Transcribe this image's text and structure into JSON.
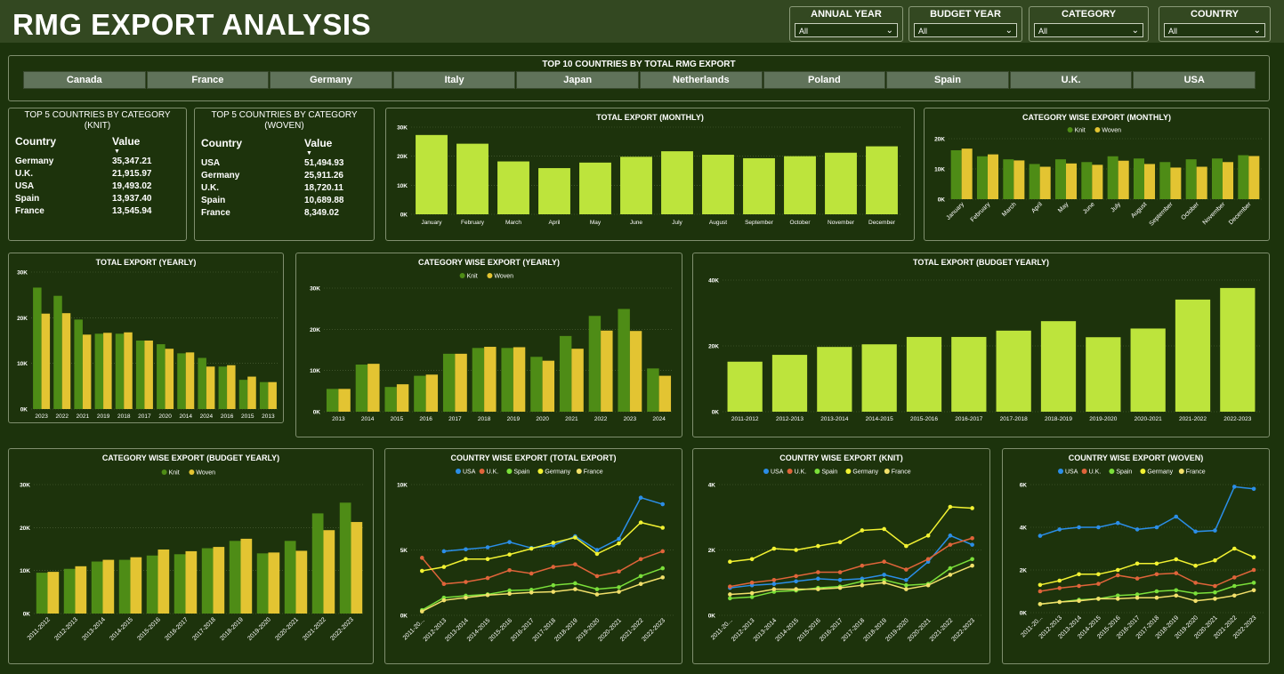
{
  "header": {
    "title": "RMG EXPORT ANALYSIS"
  },
  "filters": [
    {
      "label": "ANNUAL YEAR",
      "value": "All"
    },
    {
      "label": "BUDGET YEAR",
      "value": "All"
    },
    {
      "label": "CATEGORY",
      "value": "All"
    },
    {
      "label": "COUNTRY",
      "value": "All"
    }
  ],
  "colors": {
    "knit": "#4e8c16",
    "woven": "#e3c432",
    "total": "#bde43c",
    "USA": "#2b8ee8",
    "U.K.": "#e0643a",
    "Spain": "#7be03a",
    "Germany": "#f2f232",
    "France": "#f2e06a"
  },
  "top10": {
    "title": "TOP 10 COUNTRIES BY TOTAL RMG EXPORT",
    "countries": [
      "Canada",
      "France",
      "Germany",
      "Italy",
      "Japan",
      "Netherlands",
      "Poland",
      "Spain",
      "U.K.",
      "USA"
    ]
  },
  "knit_table": {
    "title": "TOP 5 COUNTRIES BY CATEGORY (KNIT)",
    "col_country": "Country",
    "col_value": "Value",
    "rows": [
      [
        "Germany",
        "35,347.21"
      ],
      [
        "U.K.",
        "21,915.97"
      ],
      [
        "USA",
        "19,493.02"
      ],
      [
        "Spain",
        "13,937.40"
      ],
      [
        "France",
        "13,545.94"
      ]
    ]
  },
  "woven_table": {
    "title": "TOP 5 COUNTRIES BY CATEGORY (WOVEN)",
    "col_country": "Country",
    "col_value": "Value",
    "rows": [
      [
        "USA",
        "51,494.93"
      ],
      [
        "Germany",
        "25,911.26"
      ],
      [
        "U.K.",
        "18,720.11"
      ],
      [
        "Spain",
        "10,689.88"
      ],
      [
        "France",
        "8,349.02"
      ]
    ]
  },
  "chart_data": [
    {
      "id": "monthly",
      "type": "bar",
      "title": "TOTAL EXPORT (MONTHLY)",
      "categories": [
        "January",
        "February",
        "March",
        "April",
        "May",
        "June",
        "July",
        "August",
        "September",
        "October",
        "November",
        "December"
      ],
      "values": [
        27300,
        24300,
        18200,
        15900,
        17800,
        19800,
        21700,
        20500,
        19300,
        20000,
        21200,
        23400
      ],
      "yticks": [
        "0K",
        "10K",
        "20K",
        "30K"
      ],
      "ylim": [
        0,
        30000
      ]
    },
    {
      "id": "cat_monthly",
      "type": "bar",
      "title": "CATEGORY WISE EXPORT (MONTHLY)",
      "categories": [
        "January",
        "February",
        "March",
        "April",
        "May",
        "June",
        "July",
        "August",
        "September",
        "October",
        "November",
        "December"
      ],
      "series": [
        {
          "name": "Knit",
          "values": [
            17800,
            15600,
            14500,
            12800,
            14500,
            13500,
            15600,
            14800,
            13500,
            14500,
            14800,
            16000
          ]
        },
        {
          "name": "Woven",
          "values": [
            18400,
            16300,
            14100,
            11800,
            13000,
            12500,
            14000,
            12800,
            11500,
            11800,
            13500,
            15700
          ]
        }
      ],
      "yticks": [
        "0K",
        "10K",
        "20K"
      ],
      "ylim": [
        0,
        22000
      ]
    },
    {
      "id": "yearly",
      "type": "bar",
      "title": "TOTAL EXPORT (YEARLY)",
      "categories": [
        "2023",
        "2022",
        "2021",
        "2019",
        "2018",
        "2017",
        "2020",
        "2014",
        "2024",
        "2016",
        "2015",
        "2013"
      ],
      "series": [
        {
          "name": "Knit",
          "values": [
            26600,
            24800,
            19600,
            16500,
            16500,
            15000,
            14200,
            12200,
            11200,
            9300,
            6400,
            5900
          ]
        },
        {
          "name": "Woven",
          "values": [
            20900,
            21000,
            16300,
            16700,
            16800,
            15000,
            13200,
            12400,
            9300,
            9600,
            7100,
            5900
          ]
        }
      ],
      "yticks": [
        "0K",
        "10K",
        "20K",
        "30K"
      ],
      "ylim": [
        0,
        30000
      ]
    },
    {
      "id": "cat_yearly",
      "type": "bar",
      "title": "CATEGORY WISE EXPORT (YEARLY)",
      "categories": [
        "2013",
        "2014",
        "2015",
        "2016",
        "2017",
        "2018",
        "2019",
        "2020",
        "2021",
        "2022",
        "2023",
        "2024"
      ],
      "series": [
        {
          "name": "Knit",
          "values": [
            5900,
            12200,
            6400,
            9300,
            15000,
            16500,
            16500,
            14200,
            19600,
            24800,
            26600,
            11200
          ]
        },
        {
          "name": "Woven",
          "values": [
            5900,
            12400,
            7100,
            9600,
            15000,
            16800,
            16700,
            13200,
            16300,
            21000,
            20900,
            9300
          ]
        }
      ],
      "yticks": [
        "0K",
        "10K",
        "20K",
        "30K"
      ],
      "ylim": [
        0,
        32000
      ]
    },
    {
      "id": "budget_yearly",
      "type": "bar",
      "title": "TOTAL EXPORT (BUDGET YEARLY)",
      "categories": [
        "2011-2012",
        "2012-2013",
        "2013-2014",
        "2014-2015",
        "2015-2016",
        "2016-2017",
        "2017-2018",
        "2018-2019",
        "2019-2020",
        "2020-2021",
        "2021-2022",
        "2022-2023"
      ],
      "values": [
        19000,
        21600,
        24600,
        25600,
        28400,
        28400,
        30800,
        34400,
        28300,
        31600,
        42600,
        47000
      ],
      "yticks": [
        "0K",
        "20K",
        "40K"
      ],
      "ylim": [
        0,
        50000
      ]
    },
    {
      "id": "cat_budget",
      "type": "bar",
      "title": "CATEGORY WISE EXPORT (BUDGET YEARLY)",
      "categories": [
        "2011-2012",
        "2012-2013",
        "2013-2014",
        "2014-2015",
        "2015-2016",
        "2016-2017",
        "2017-2018",
        "2018-2019",
        "2019-2020",
        "2020-2021",
        "2021-2022",
        "2022-2023"
      ],
      "series": [
        {
          "name": "Knit",
          "values": [
            9500,
            10400,
            12100,
            12500,
            13500,
            13800,
            15200,
            16900,
            14000,
            16900,
            23300,
            25800
          ]
        },
        {
          "name": "Woven",
          "values": [
            9700,
            11000,
            12500,
            13100,
            14900,
            14500,
            15500,
            17400,
            14200,
            14600,
            19400,
            21300
          ]
        }
      ],
      "yticks": [
        "0K",
        "10K",
        "20K",
        "30K"
      ],
      "ylim": [
        0,
        30000
      ]
    },
    {
      "id": "country_total",
      "type": "line",
      "title": "COUNTRY WISE EXPORT (TOTAL EXPORT)",
      "categories": [
        "2011-20...",
        "2012-2013",
        "2013-2014",
        "2014-2015",
        "2015-2016",
        "2016-2017",
        "2017-2018",
        "2018-2019",
        "2019-2020",
        "2020-2021",
        "2021-2022",
        "2022-2023"
      ],
      "series": [
        {
          "name": "USA",
          "values": [
            null,
            4900,
            5050,
            5200,
            5600,
            5150,
            5350,
            6050,
            5000,
            5850,
            9000,
            8500
          ]
        },
        {
          "name": "U.K.",
          "values": [
            4400,
            2400,
            2550,
            2850,
            3450,
            3200,
            3700,
            3900,
            3000,
            3350,
            4300,
            4900
          ]
        },
        {
          "name": "Spain",
          "values": [
            400,
            1350,
            1500,
            1600,
            1900,
            1950,
            2300,
            2450,
            2000,
            2150,
            3000,
            3600
          ]
        },
        {
          "name": "Germany",
          "values": [
            3400,
            3700,
            4300,
            4300,
            4650,
            5100,
            5550,
            5950,
            4700,
            5500,
            7100,
            6700
          ]
        },
        {
          "name": "France",
          "values": [
            300,
            1150,
            1350,
            1550,
            1650,
            1750,
            1800,
            2000,
            1600,
            1800,
            2400,
            2900
          ]
        }
      ],
      "yticks": [
        "0K",
        "5K",
        "10K"
      ],
      "ylim": [
        0,
        10000
      ]
    },
    {
      "id": "country_knit",
      "type": "line",
      "title": "COUNTRY WISE EXPORT (KNIT)",
      "categories": [
        "2011-20...",
        "2012-2013",
        "2013-2014",
        "2014-2015",
        "2015-2016",
        "2016-2017",
        "2017-2018",
        "2018-2019",
        "2019-2020",
        "2020-2021",
        "2021-2022",
        "2022-2023"
      ],
      "series": [
        {
          "name": "USA",
          "values": [
            1050,
            1150,
            1200,
            1300,
            1400,
            1350,
            1400,
            1550,
            1350,
            2050,
            3050,
            2700
          ]
        },
        {
          "name": "U.K.",
          "values": [
            1100,
            1250,
            1350,
            1500,
            1650,
            1650,
            1900,
            2050,
            1750,
            2150,
            2700,
            2950
          ]
        },
        {
          "name": "Spain",
          "values": [
            650,
            700,
            900,
            950,
            1050,
            1100,
            1300,
            1350,
            1150,
            1200,
            1800,
            2150
          ]
        },
        {
          "name": "Germany",
          "values": [
            2050,
            2150,
            2550,
            2500,
            2650,
            2800,
            3250,
            3300,
            2650,
            3050,
            4150,
            4100
          ]
        },
        {
          "name": "France",
          "values": [
            800,
            850,
            1000,
            1000,
            1000,
            1050,
            1150,
            1250,
            1000,
            1150,
            1550,
            1900
          ]
        }
      ],
      "yticks": [
        "0K",
        "2K",
        "4K"
      ],
      "ylim": [
        0,
        5000
      ]
    },
    {
      "id": "country_woven",
      "type": "line",
      "title": "COUNTRY WISE EXPORT (WOVEN)",
      "categories": [
        "2011-20...",
        "2012-2013",
        "2013-2014",
        "2014-2015",
        "2015-2016",
        "2016-2017",
        "2017-2018",
        "2018-2019",
        "2019-2020",
        "2020-2021",
        "2021-2022",
        "2022-2023"
      ],
      "series": [
        {
          "name": "USA",
          "values": [
            3600,
            3900,
            4000,
            4000,
            4200,
            3900,
            4000,
            4500,
            3800,
            3850,
            5900,
            5800
          ]
        },
        {
          "name": "U.K.",
          "values": [
            1000,
            1150,
            1250,
            1350,
            1750,
            1600,
            1800,
            1850,
            1400,
            1250,
            1650,
            2000
          ]
        },
        {
          "name": "Spain",
          "values": [
            400,
            500,
            600,
            650,
            800,
            850,
            1000,
            1050,
            900,
            950,
            1250,
            1400
          ]
        },
        {
          "name": "Germany",
          "values": [
            1300,
            1500,
            1800,
            1800,
            2000,
            2300,
            2300,
            2500,
            2200,
            2450,
            3000,
            2600
          ]
        },
        {
          "name": "France",
          "values": [
            400,
            500,
            550,
            650,
            650,
            700,
            700,
            800,
            550,
            650,
            800,
            1050
          ]
        }
      ],
      "yticks": [
        "0K",
        "2K",
        "4K",
        "6K"
      ],
      "ylim": [
        0,
        6000
      ]
    }
  ]
}
